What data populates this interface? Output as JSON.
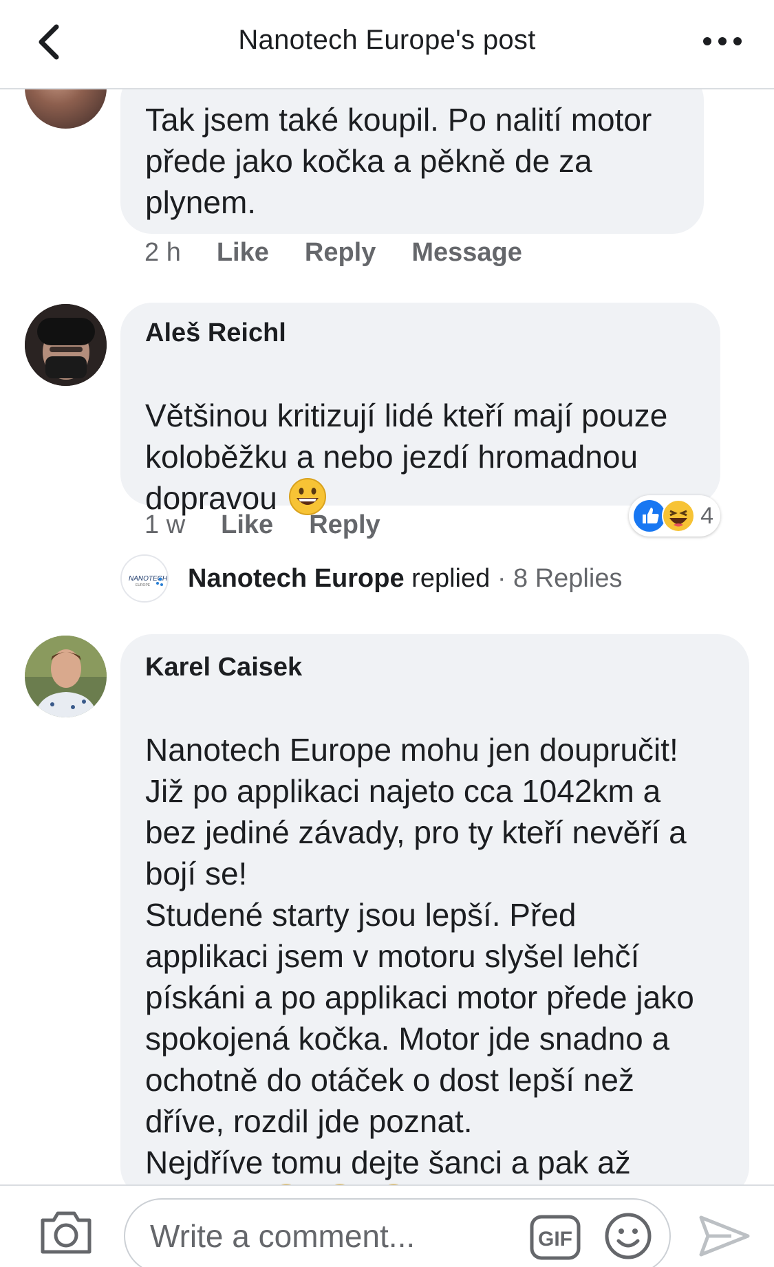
{
  "header": {
    "title": "Nanotech Europe's post"
  },
  "comments": [
    {
      "author": "",
      "text": "Tak jsem také koupil. Po nalití motor\npřede jako kočka a pěkně de za\nplynem.",
      "time": "2 h",
      "actions": [
        "Like",
        "Reply",
        "Message"
      ]
    },
    {
      "author": "Aleš Reichl",
      "text": "Většinou kritizují lidé kteří mají pouze\nkoloběžku a nebo jezdí hromadnou\ndopravou",
      "emoji": "grinning-face",
      "time": "1 w",
      "actions": [
        "Like",
        "Reply"
      ],
      "reactions": {
        "types": [
          "like-icon",
          "laughing-icon"
        ],
        "count": "4"
      },
      "replies_summary": {
        "name": "Nanotech Europe",
        "verb": "replied",
        "separator": "·",
        "count_text": "8 Replies"
      }
    },
    {
      "author": "Karel Caisek",
      "text": "Nanotech Europe  mohu jen doupručit!\nJiž po applikaci najeto cca 1042km a\nbez jediné závady, pro ty kteří nevěří a\nbojí se!\nStudené starty jsou lepší. Před\napplikaci jsem v motoru slyšel lehčí\npískáni a po applikaci motor přede jako\nspokojená kočka. Motor jde snadno a\nochotně do otáček o dost lepší než\ndříve, rozdil jde poznat.\nNejdříve tomu dejte šanci a pak až\nhejtujte!",
      "emoji": "grinning-face"
    }
  ],
  "composer": {
    "placeholder": "Write a comment...",
    "gif_label": "GIF"
  },
  "colors": {
    "bubble": "#f0f2f5",
    "muted_text": "#65676b",
    "like_blue": "#1877f2",
    "emoji_yellow": "#f7c335"
  }
}
